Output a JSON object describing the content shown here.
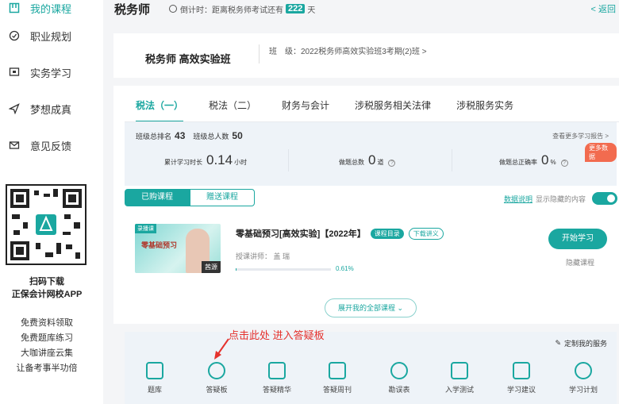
{
  "sidebar": {
    "items": [
      {
        "label": "我的课程",
        "icon": "book-icon"
      },
      {
        "label": "职业规划",
        "icon": "compass-icon"
      },
      {
        "label": "实务学习",
        "icon": "screen-icon"
      },
      {
        "label": "梦想成真",
        "icon": "send-icon"
      },
      {
        "label": "意见反馈",
        "icon": "mail-icon"
      }
    ],
    "qr_caption_1": "扫码下载",
    "qr_caption_2": "正保会计网校APP",
    "links": [
      "免费资料领取",
      "免费题库练习",
      "大咖讲座云集",
      "让备考事半功倍"
    ]
  },
  "topbar": {
    "title": "税务师",
    "countdown_prefix": "倒计时：距离税务师考试还有",
    "countdown_days": "222",
    "countdown_suffix": "天",
    "back": "< 返回"
  },
  "class_card": {
    "name": "税务师 高效实验班",
    "class_label": "班　级：",
    "class_value": "2022税务师高效实验班3考期(2)班 >"
  },
  "tabs": [
    "税法（一）",
    "税法（二）",
    "财务与会计",
    "涉税服务相关法律",
    "涉税服务实务"
  ],
  "stats": {
    "rank_label": "班级总排名",
    "rank_value": "43",
    "total_label": "班级总人数",
    "total_value": "50",
    "more_report": "查看更多学习报告 >",
    "study_label": "累计学习时长",
    "study_value": "0.14",
    "study_unit": "小时",
    "questions_label": "做题总数",
    "questions_value": "0",
    "questions_unit": "道",
    "accuracy_label": "做题总正确率",
    "accuracy_value": "0",
    "accuracy_unit": "%",
    "more_data": "更多数据"
  },
  "segment": {
    "purchased": "已购课程",
    "gift": "赠送课程"
  },
  "tools": {
    "data_note": "数据说明",
    "show_hidden": "显示隐藏的内容"
  },
  "course": {
    "tag": "录播课",
    "thumb_title": "零基础预习",
    "teacher_badge": "茜源",
    "title": "零基础预习[高效实验]【2022年】",
    "catalog": "课程目录",
    "download": "下载讲义",
    "teacher_line": "授课讲师：  盖  瑞",
    "progress": 0.0061,
    "progress_text": "0.61%",
    "start": "开始学习",
    "hide": "隐藏课程"
  },
  "expand_label": "展开我的全部课程  ⌄",
  "annotation": "点击此处 进入答疑板",
  "services": {
    "custom": "定制我的服务",
    "items": [
      "题库",
      "答疑板",
      "答疑精华",
      "答疑周刊",
      "勘误表",
      "入学测试",
      "学习建议",
      "学习计划"
    ]
  },
  "colors": {
    "accent": "#1aa7a0",
    "annotation": "#e5322d",
    "badge": "#f26b4f"
  }
}
